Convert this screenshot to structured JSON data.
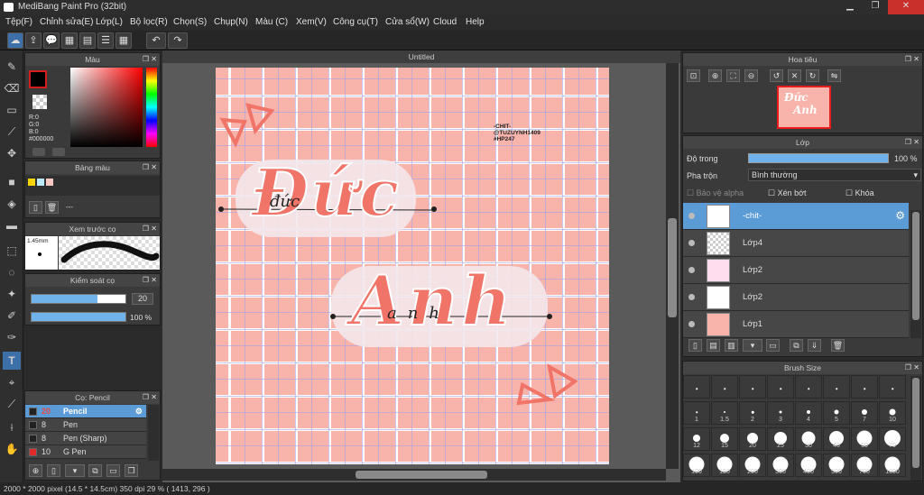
{
  "app": {
    "title": "MediBang Paint Pro (32bit)"
  },
  "window": {
    "minimize": "▁",
    "maximize": "❐",
    "close": "✕"
  },
  "menu": [
    "Tệp(F)",
    "Chỉnh sửa(E)",
    "Lớp(L)",
    "Bộ lọc(R)",
    "Chọn(S)",
    "Chụp(N)",
    "Màu (C)",
    "Xem(V)",
    "Công cụ(T)",
    "Cửa sổ(W)",
    "Cloud",
    "Help"
  ],
  "color_panel": {
    "title": "Màu",
    "r": "R:0",
    "g": "G:0",
    "b": "B:0",
    "hex": "#000000"
  },
  "palette_panel": {
    "title": "Bảng màu",
    "dash": "---",
    "swatches": [
      "#f5d400",
      "#b9e8f8",
      "#f7c7c0"
    ]
  },
  "preview_panel": {
    "title": "Xem trước cọ",
    "size": "1.45mm"
  },
  "brush_control": {
    "title": "Kiểm soát cọ",
    "size_value": "20",
    "opacity_value": "100 %",
    "size_frac": 0.2,
    "opacity_frac": 1.0
  },
  "brush_list": {
    "title": "Cọ: Pencil",
    "items": [
      {
        "size": "20",
        "name": "Pencil",
        "color": "#222222",
        "selected": true
      },
      {
        "size": "8",
        "name": "Pen",
        "color": "#222222",
        "selected": false
      },
      {
        "size": "8",
        "name": "Pen (Sharp)",
        "color": "#222222",
        "selected": false
      },
      {
        "size": "10",
        "name": "G Pen",
        "color": "#e02a2a",
        "selected": false
      }
    ]
  },
  "canvas": {
    "tab_title": "Untitled",
    "watermark_lines": [
      "-CHIT-",
      "@TUZUYNH1409",
      "#HP247"
    ],
    "text_top": "Đức",
    "text_bottom": "Anh",
    "script_top": "đức",
    "script_bottom": "anh"
  },
  "navigator": {
    "title": "Hoa tiêu"
  },
  "layer_panel": {
    "title": "Lớp",
    "opacity_label": "Độ trong",
    "opacity_value": "100 %",
    "blend_label": "Pha trộn",
    "blend_value": "Bình thường",
    "protect_alpha": "Bảo vệ alpha",
    "clipping": "Xén bớt",
    "lock": "Khóa",
    "layers": [
      {
        "name": "-chit-",
        "selected": true
      },
      {
        "name": "Lớp4",
        "selected": false
      },
      {
        "name": "Lớp2",
        "selected": false
      },
      {
        "name": "Lớp2",
        "selected": false
      },
      {
        "name": "Lớp1",
        "selected": false
      }
    ]
  },
  "brush_size_panel": {
    "title": "Brush Size",
    "sizes": [
      "",
      "",
      "",
      "",
      "",
      "",
      "",
      "",
      "1",
      "1.5",
      "2",
      "3",
      "4",
      "5",
      "7",
      "10",
      "12",
      "15",
      "20",
      "25",
      "30",
      "40",
      "50",
      "70",
      "100",
      "150",
      "200",
      "300",
      "400",
      "500",
      "700",
      "1000"
    ]
  },
  "status": {
    "text": "2000 * 2000 pixel   (14.5 * 14.5cm)   350 dpi   29 %   ( 1413, 296 )"
  },
  "colors": {
    "accent": "#5b9bd6",
    "canvas_pink": "#f8b3aa",
    "text_salmon": "#f07468",
    "foreground": "#000000"
  }
}
